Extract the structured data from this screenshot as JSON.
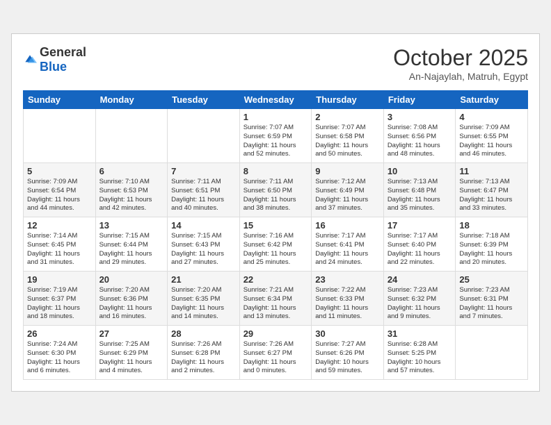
{
  "header": {
    "logo_text_general": "General",
    "logo_text_blue": "Blue",
    "month_title": "October 2025",
    "subtitle": "An-Najaylah, Matruh, Egypt"
  },
  "weekdays": [
    "Sunday",
    "Monday",
    "Tuesday",
    "Wednesday",
    "Thursday",
    "Friday",
    "Saturday"
  ],
  "weeks": [
    [
      {
        "day": "",
        "info": ""
      },
      {
        "day": "",
        "info": ""
      },
      {
        "day": "",
        "info": ""
      },
      {
        "day": "1",
        "info": "Sunrise: 7:07 AM\nSunset: 6:59 PM\nDaylight: 11 hours\nand 52 minutes."
      },
      {
        "day": "2",
        "info": "Sunrise: 7:07 AM\nSunset: 6:58 PM\nDaylight: 11 hours\nand 50 minutes."
      },
      {
        "day": "3",
        "info": "Sunrise: 7:08 AM\nSunset: 6:56 PM\nDaylight: 11 hours\nand 48 minutes."
      },
      {
        "day": "4",
        "info": "Sunrise: 7:09 AM\nSunset: 6:55 PM\nDaylight: 11 hours\nand 46 minutes."
      }
    ],
    [
      {
        "day": "5",
        "info": "Sunrise: 7:09 AM\nSunset: 6:54 PM\nDaylight: 11 hours\nand 44 minutes."
      },
      {
        "day": "6",
        "info": "Sunrise: 7:10 AM\nSunset: 6:53 PM\nDaylight: 11 hours\nand 42 minutes."
      },
      {
        "day": "7",
        "info": "Sunrise: 7:11 AM\nSunset: 6:51 PM\nDaylight: 11 hours\nand 40 minutes."
      },
      {
        "day": "8",
        "info": "Sunrise: 7:11 AM\nSunset: 6:50 PM\nDaylight: 11 hours\nand 38 minutes."
      },
      {
        "day": "9",
        "info": "Sunrise: 7:12 AM\nSunset: 6:49 PM\nDaylight: 11 hours\nand 37 minutes."
      },
      {
        "day": "10",
        "info": "Sunrise: 7:13 AM\nSunset: 6:48 PM\nDaylight: 11 hours\nand 35 minutes."
      },
      {
        "day": "11",
        "info": "Sunrise: 7:13 AM\nSunset: 6:47 PM\nDaylight: 11 hours\nand 33 minutes."
      }
    ],
    [
      {
        "day": "12",
        "info": "Sunrise: 7:14 AM\nSunset: 6:45 PM\nDaylight: 11 hours\nand 31 minutes."
      },
      {
        "day": "13",
        "info": "Sunrise: 7:15 AM\nSunset: 6:44 PM\nDaylight: 11 hours\nand 29 minutes."
      },
      {
        "day": "14",
        "info": "Sunrise: 7:15 AM\nSunset: 6:43 PM\nDaylight: 11 hours\nand 27 minutes."
      },
      {
        "day": "15",
        "info": "Sunrise: 7:16 AM\nSunset: 6:42 PM\nDaylight: 11 hours\nand 25 minutes."
      },
      {
        "day": "16",
        "info": "Sunrise: 7:17 AM\nSunset: 6:41 PM\nDaylight: 11 hours\nand 24 minutes."
      },
      {
        "day": "17",
        "info": "Sunrise: 7:17 AM\nSunset: 6:40 PM\nDaylight: 11 hours\nand 22 minutes."
      },
      {
        "day": "18",
        "info": "Sunrise: 7:18 AM\nSunset: 6:39 PM\nDaylight: 11 hours\nand 20 minutes."
      }
    ],
    [
      {
        "day": "19",
        "info": "Sunrise: 7:19 AM\nSunset: 6:37 PM\nDaylight: 11 hours\nand 18 minutes."
      },
      {
        "day": "20",
        "info": "Sunrise: 7:20 AM\nSunset: 6:36 PM\nDaylight: 11 hours\nand 16 minutes."
      },
      {
        "day": "21",
        "info": "Sunrise: 7:20 AM\nSunset: 6:35 PM\nDaylight: 11 hours\nand 14 minutes."
      },
      {
        "day": "22",
        "info": "Sunrise: 7:21 AM\nSunset: 6:34 PM\nDaylight: 11 hours\nand 13 minutes."
      },
      {
        "day": "23",
        "info": "Sunrise: 7:22 AM\nSunset: 6:33 PM\nDaylight: 11 hours\nand 11 minutes."
      },
      {
        "day": "24",
        "info": "Sunrise: 7:23 AM\nSunset: 6:32 PM\nDaylight: 11 hours\nand 9 minutes."
      },
      {
        "day": "25",
        "info": "Sunrise: 7:23 AM\nSunset: 6:31 PM\nDaylight: 11 hours\nand 7 minutes."
      }
    ],
    [
      {
        "day": "26",
        "info": "Sunrise: 7:24 AM\nSunset: 6:30 PM\nDaylight: 11 hours\nand 6 minutes."
      },
      {
        "day": "27",
        "info": "Sunrise: 7:25 AM\nSunset: 6:29 PM\nDaylight: 11 hours\nand 4 minutes."
      },
      {
        "day": "28",
        "info": "Sunrise: 7:26 AM\nSunset: 6:28 PM\nDaylight: 11 hours\nand 2 minutes."
      },
      {
        "day": "29",
        "info": "Sunrise: 7:26 AM\nSunset: 6:27 PM\nDaylight: 11 hours\nand 0 minutes."
      },
      {
        "day": "30",
        "info": "Sunrise: 7:27 AM\nSunset: 6:26 PM\nDaylight: 10 hours\nand 59 minutes."
      },
      {
        "day": "31",
        "info": "Sunrise: 6:28 AM\nSunset: 5:25 PM\nDaylight: 10 hours\nand 57 minutes."
      },
      {
        "day": "",
        "info": ""
      }
    ]
  ]
}
